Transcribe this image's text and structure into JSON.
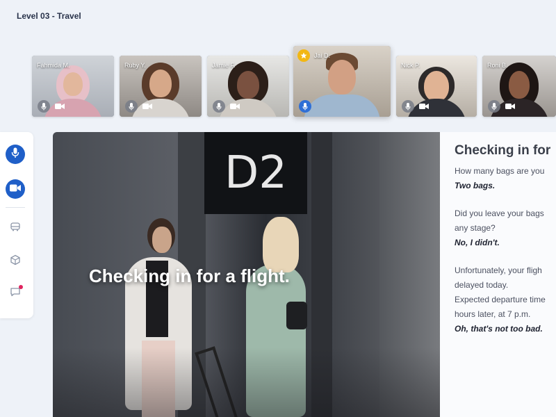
{
  "header": {
    "title": "Level 03 - Travel"
  },
  "participants": [
    {
      "name": "Fahmida M.",
      "mic_icon": "mic-icon",
      "cam_icon": "camera-icon",
      "mic_active": false,
      "host": false
    },
    {
      "name": "Ruby Y.",
      "mic_icon": "mic-icon",
      "cam_icon": "camera-icon",
      "mic_active": false,
      "host": false
    },
    {
      "name": "Jamie F.",
      "mic_icon": "mic-icon",
      "cam_icon": "camera-icon",
      "mic_active": false,
      "host": false
    },
    {
      "name": "Jai D.",
      "mic_icon": "mic-icon",
      "cam_icon": "camera-icon",
      "mic_active": true,
      "host": true,
      "badge_icon": "star-icon"
    },
    {
      "name": "Nick P.",
      "mic_icon": "mic-icon",
      "cam_icon": "camera-icon",
      "mic_active": false,
      "host": false
    },
    {
      "name": "Roni B.",
      "mic_icon": "mic-icon",
      "cam_icon": "camera-icon",
      "mic_active": false,
      "host": false
    }
  ],
  "toolbar": {
    "items": [
      {
        "icon": "microphone-icon",
        "active": true
      },
      {
        "icon": "video-camera-icon",
        "active": true
      },
      {
        "icon": "vehicle-icon",
        "active": false
      },
      {
        "icon": "cube-icon",
        "active": false
      },
      {
        "icon": "chat-icon",
        "active": false,
        "notification": true
      }
    ],
    "accent_color": "#1f5fc8",
    "notification_color": "#e0245e"
  },
  "video": {
    "caption": "Checking in for a flight.",
    "sign_text": "D2"
  },
  "transcript": {
    "title": "Checking in for",
    "blocks": [
      {
        "lines": [
          "How many bags are you"
        ],
        "answer": "Two bags."
      },
      {
        "lines": [
          "Did you leave your bags",
          "any stage?"
        ],
        "answer": "No, I didn't."
      },
      {
        "lines": [
          "Unfortunately, your fligh",
          "delayed today.",
          "Expected departure time",
          "hours later, at 7 p.m."
        ],
        "answer": "Oh, that's not too bad."
      }
    ]
  }
}
